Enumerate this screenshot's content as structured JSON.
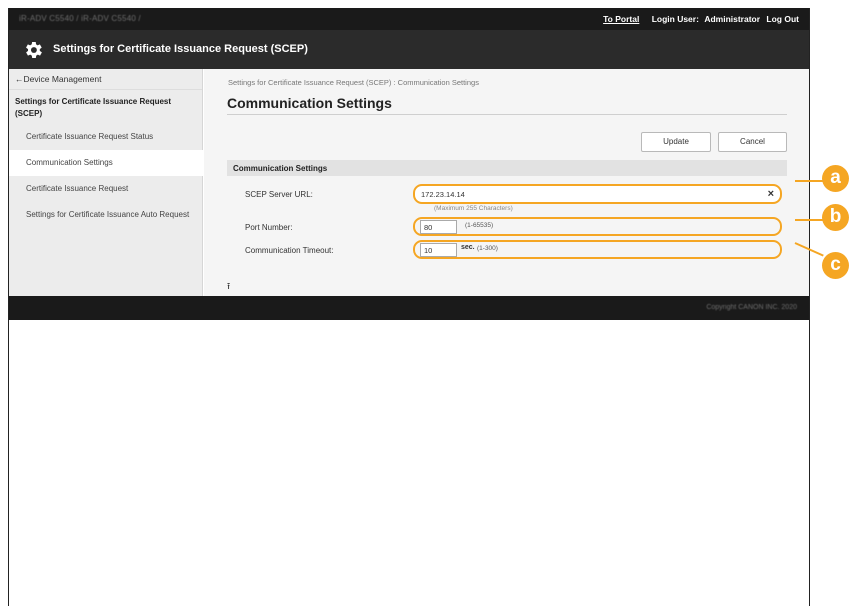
{
  "topbar": {
    "device_name": "iR-ADV C5540 / iR-ADV C5540 /",
    "portal_link": "To Portal",
    "login_user_label": "Login User:",
    "login_user": "Administrator",
    "logout": "Log Out"
  },
  "titlebar": {
    "title": "Settings for Certificate Issuance Request (SCEP)",
    "icon": "gear-icon"
  },
  "sidebar": {
    "back_link": "←Device Management",
    "section_title": "Settings for Certificate Issuance Request (SCEP)",
    "items": [
      {
        "label": "Certificate Issuance Request Status"
      },
      {
        "label": "Communication Settings"
      },
      {
        "label": "Certificate Issuance Request"
      },
      {
        "label": "Settings for Certificate Issuance Auto Request"
      }
    ]
  },
  "main": {
    "breadcrumb": "Settings for Certificate Issuance Request (SCEP) : Communication Settings",
    "page_title": "Communication Settings",
    "update_button": "Update",
    "cancel_button": "Cancel",
    "panel_title": "Communication Settings",
    "url": {
      "label": "SCEP Server URL:",
      "value": "172.23.14.14",
      "note": "(Maximum 255 Characters)",
      "clear_icon": "×"
    },
    "port": {
      "label": "Port Number:",
      "value": "80",
      "range": "(1-65535)"
    },
    "timeout": {
      "label": "Communication Timeout:",
      "value": "10",
      "unit": "sec.",
      "range": "(1-300)"
    },
    "to_top_icon": "⭱"
  },
  "footer": {
    "copyright": "Copyright CANON INC. 2020"
  },
  "callouts": {
    "a": "a",
    "b": "b",
    "c": "c"
  },
  "colors": {
    "accent": "#f5a623",
    "topbar": "#1a1a1a",
    "titlebar": "#2b2b2b"
  }
}
